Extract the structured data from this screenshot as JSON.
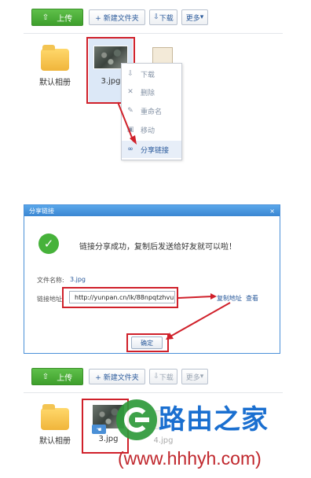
{
  "panel1": {
    "upload_label": "上传",
    "new_folder_label": "+ 新建文件夹",
    "download_label": "下载",
    "more_label": "更多",
    "folder_label": "默认相册",
    "file_label": "3.jpg",
    "menu": [
      "下载",
      "删除",
      "重命名",
      "移动",
      "分享链接"
    ]
  },
  "dialog": {
    "title": "分享链接",
    "close": "×",
    "success_message": "链接分享成功，复制后发送给好友就可以啦！",
    "file_name_label": "文件名称:",
    "file_name_value": "3.jpg",
    "link_label": "链接地址",
    "link_value": "http://yunpan.cn/lk/88npqtzhvu",
    "copy_label": "复制地址",
    "view_label": "查看",
    "ok_label": "确定"
  },
  "panel3": {
    "upload_label": "上传",
    "new_folder_label": "+ 新建文件夹",
    "download_label": "下载",
    "more_label": "更多",
    "folder_label": "默认相册",
    "file_label": "3.jpg",
    "faded_file_label": "4.jpg"
  },
  "watermark": {
    "brand": "路由之家",
    "url": "(www.hhhyh.com)"
  },
  "colors": {
    "accent_green": "#3e9f2c",
    "highlight_red": "#d0202a",
    "link_blue": "#2a5a9b",
    "dialog_blue": "#3a86d2",
    "watermark_blue": "#1a6fd0"
  }
}
